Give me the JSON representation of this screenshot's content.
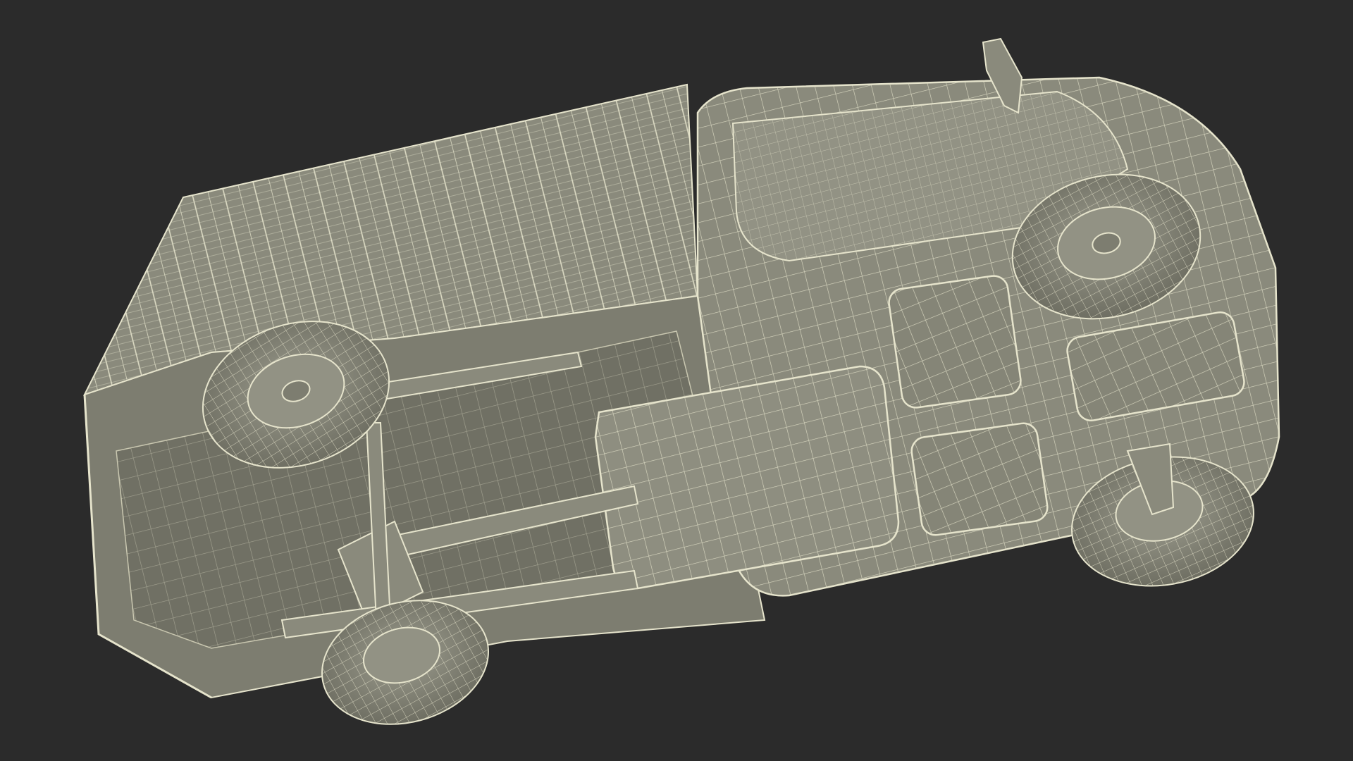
{
  "scene": {
    "subject": "pickup-truck-wireframe-underside",
    "colors": {
      "background": "#2b2b2b",
      "surface": "#8a8a7c",
      "surface_dark": "#6e6e62",
      "surface_light": "#9c9c8e",
      "wire": "#e6e4cc",
      "wire_dim": "#c9c7b0"
    }
  }
}
